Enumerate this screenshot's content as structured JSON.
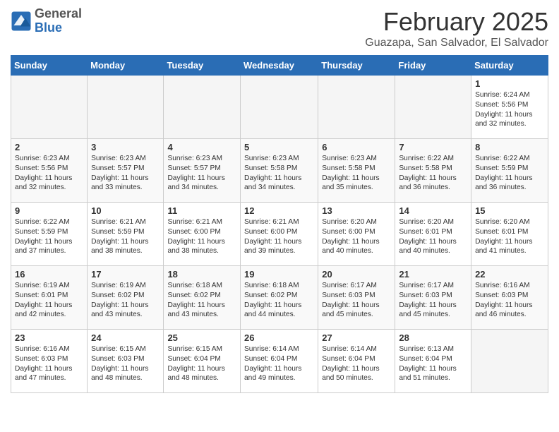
{
  "header": {
    "logo": {
      "general": "General",
      "blue": "Blue"
    },
    "title": "February 2025",
    "location": "Guazapa, San Salvador, El Salvador"
  },
  "calendar": {
    "days_of_week": [
      "Sunday",
      "Monday",
      "Tuesday",
      "Wednesday",
      "Thursday",
      "Friday",
      "Saturday"
    ],
    "weeks": [
      [
        {
          "day": "",
          "info": ""
        },
        {
          "day": "",
          "info": ""
        },
        {
          "day": "",
          "info": ""
        },
        {
          "day": "",
          "info": ""
        },
        {
          "day": "",
          "info": ""
        },
        {
          "day": "",
          "info": ""
        },
        {
          "day": "1",
          "info": "Sunrise: 6:24 AM\nSunset: 5:56 PM\nDaylight: 11 hours\nand 32 minutes."
        }
      ],
      [
        {
          "day": "2",
          "info": "Sunrise: 6:23 AM\nSunset: 5:56 PM\nDaylight: 11 hours\nand 32 minutes."
        },
        {
          "day": "3",
          "info": "Sunrise: 6:23 AM\nSunset: 5:57 PM\nDaylight: 11 hours\nand 33 minutes."
        },
        {
          "day": "4",
          "info": "Sunrise: 6:23 AM\nSunset: 5:57 PM\nDaylight: 11 hours\nand 34 minutes."
        },
        {
          "day": "5",
          "info": "Sunrise: 6:23 AM\nSunset: 5:58 PM\nDaylight: 11 hours\nand 34 minutes."
        },
        {
          "day": "6",
          "info": "Sunrise: 6:23 AM\nSunset: 5:58 PM\nDaylight: 11 hours\nand 35 minutes."
        },
        {
          "day": "7",
          "info": "Sunrise: 6:22 AM\nSunset: 5:58 PM\nDaylight: 11 hours\nand 36 minutes."
        },
        {
          "day": "8",
          "info": "Sunrise: 6:22 AM\nSunset: 5:59 PM\nDaylight: 11 hours\nand 36 minutes."
        }
      ],
      [
        {
          "day": "9",
          "info": "Sunrise: 6:22 AM\nSunset: 5:59 PM\nDaylight: 11 hours\nand 37 minutes."
        },
        {
          "day": "10",
          "info": "Sunrise: 6:21 AM\nSunset: 5:59 PM\nDaylight: 11 hours\nand 38 minutes."
        },
        {
          "day": "11",
          "info": "Sunrise: 6:21 AM\nSunset: 6:00 PM\nDaylight: 11 hours\nand 38 minutes."
        },
        {
          "day": "12",
          "info": "Sunrise: 6:21 AM\nSunset: 6:00 PM\nDaylight: 11 hours\nand 39 minutes."
        },
        {
          "day": "13",
          "info": "Sunrise: 6:20 AM\nSunset: 6:00 PM\nDaylight: 11 hours\nand 40 minutes."
        },
        {
          "day": "14",
          "info": "Sunrise: 6:20 AM\nSunset: 6:01 PM\nDaylight: 11 hours\nand 40 minutes."
        },
        {
          "day": "15",
          "info": "Sunrise: 6:20 AM\nSunset: 6:01 PM\nDaylight: 11 hours\nand 41 minutes."
        }
      ],
      [
        {
          "day": "16",
          "info": "Sunrise: 6:19 AM\nSunset: 6:01 PM\nDaylight: 11 hours\nand 42 minutes."
        },
        {
          "day": "17",
          "info": "Sunrise: 6:19 AM\nSunset: 6:02 PM\nDaylight: 11 hours\nand 43 minutes."
        },
        {
          "day": "18",
          "info": "Sunrise: 6:18 AM\nSunset: 6:02 PM\nDaylight: 11 hours\nand 43 minutes."
        },
        {
          "day": "19",
          "info": "Sunrise: 6:18 AM\nSunset: 6:02 PM\nDaylight: 11 hours\nand 44 minutes."
        },
        {
          "day": "20",
          "info": "Sunrise: 6:17 AM\nSunset: 6:03 PM\nDaylight: 11 hours\nand 45 minutes."
        },
        {
          "day": "21",
          "info": "Sunrise: 6:17 AM\nSunset: 6:03 PM\nDaylight: 11 hours\nand 45 minutes."
        },
        {
          "day": "22",
          "info": "Sunrise: 6:16 AM\nSunset: 6:03 PM\nDaylight: 11 hours\nand 46 minutes."
        }
      ],
      [
        {
          "day": "23",
          "info": "Sunrise: 6:16 AM\nSunset: 6:03 PM\nDaylight: 11 hours\nand 47 minutes."
        },
        {
          "day": "24",
          "info": "Sunrise: 6:15 AM\nSunset: 6:03 PM\nDaylight: 11 hours\nand 48 minutes."
        },
        {
          "day": "25",
          "info": "Sunrise: 6:15 AM\nSunset: 6:04 PM\nDaylight: 11 hours\nand 48 minutes."
        },
        {
          "day": "26",
          "info": "Sunrise: 6:14 AM\nSunset: 6:04 PM\nDaylight: 11 hours\nand 49 minutes."
        },
        {
          "day": "27",
          "info": "Sunrise: 6:14 AM\nSunset: 6:04 PM\nDaylight: 11 hours\nand 50 minutes."
        },
        {
          "day": "28",
          "info": "Sunrise: 6:13 AM\nSunset: 6:04 PM\nDaylight: 11 hours\nand 51 minutes."
        },
        {
          "day": "",
          "info": ""
        }
      ]
    ]
  }
}
